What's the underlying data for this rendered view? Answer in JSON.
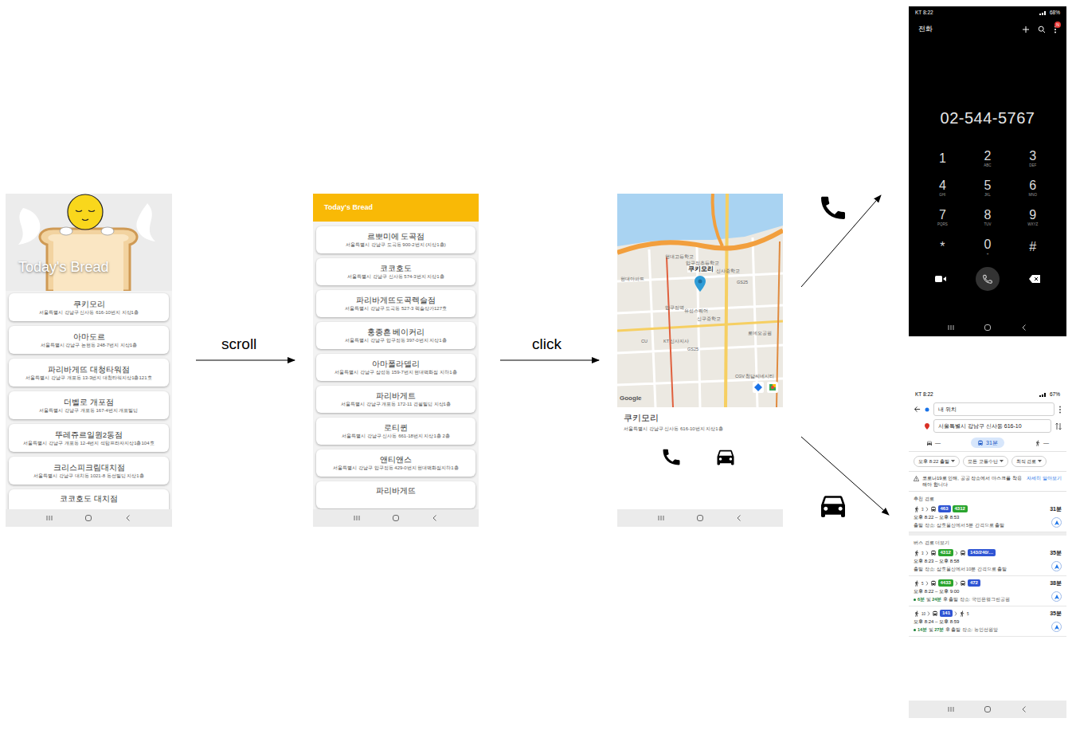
{
  "flow_labels": {
    "scroll": "scroll",
    "click": "click"
  },
  "screen1": {
    "title": "Today's Bread",
    "items": [
      {
        "name": "쿠키모리",
        "address": "서울특별시 강남구 신사동 616-10번지 지상1층"
      },
      {
        "name": "아마도르",
        "address": "서울특별시 강남구 논현동 248-7번지 지상1층"
      },
      {
        "name": "파리바게뜨 대청타워점",
        "address": "서울특별시 강남구 개포동 13-3번지 대청타워지상1층121호"
      },
      {
        "name": "더벨로 개포점",
        "address": "서울특별시 강남구 개포동 167-4번지 개포빌딩"
      },
      {
        "name": "뚜레쥬르일원2동점",
        "address": "서울특별시 강남구 개포동 12-4번지 석탑프라자지상1층104호"
      },
      {
        "name": "크리스피크림대치점",
        "address": "서울특별시 강남구 대치동 1021-8 동선빌딩 지상1층"
      }
    ],
    "partial_item": "코코호도 대치점"
  },
  "screen2": {
    "title": "Today's Bread",
    "items": [
      {
        "name": "르뽀미에 도곡점",
        "address": "서울특별시 강남구 도곡동 900-2번지 (지상1층)"
      },
      {
        "name": "코코호도",
        "address": "서울특별시 강남구 신사동 574-3번지 지상1층"
      },
      {
        "name": "파리바게뜨도곡렉슬점",
        "address": "서울특별시 강남구 도곡동 527-3 렉슬상가127호"
      },
      {
        "name": "홍종흔 베이커리",
        "address": "서울특별시 강남구 압구정동 397-0번지 지상1층"
      },
      {
        "name": "아마폴라델리",
        "address": "서울특별시 강남구 삼성동 159-7번지 현대백화점 지하1층"
      },
      {
        "name": "파리바게트",
        "address": "서울특별시 강남구 개포동 172-11 경필빌딩 지상1층"
      },
      {
        "name": "로티퀸",
        "address": "서울특별시 강남구 신사동 661-18번지 지상1층 2층"
      },
      {
        "name": "앤티앤스",
        "address": "서울특별시 강남구 압구정동 429-0번지 현대백화점지하1층"
      }
    ],
    "partial_item": "파리바게뜨"
  },
  "screen3": {
    "map": {
      "pin_label": "쿠키모리",
      "labels": [
        "현대고등학교",
        "압구정초등학교",
        "신사중학교",
        "현대아파트",
        "압구정역",
        "유성스퀘어",
        "신구중학교",
        "KT 신사지사",
        "GS25",
        "CU",
        "로데오공원",
        "CGV 청담씨네시티",
        "GS25"
      ],
      "attribution": "Google"
    },
    "name": "쿠키모리",
    "address": "서울특별시 강남구 신사동 616-10번지 지상1층"
  },
  "dialer": {
    "status": {
      "carrier_time": "KT 8:22",
      "battery": "68%"
    },
    "title": "전화",
    "badge": "N",
    "number": "02-544-5767",
    "keys": [
      {
        "digit": "1"
      },
      {
        "digit": "2",
        "letters": "ABC"
      },
      {
        "digit": "3",
        "letters": "DEF"
      },
      {
        "digit": "4",
        "letters": "GHI"
      },
      {
        "digit": "5",
        "letters": "JKL"
      },
      {
        "digit": "6",
        "letters": "MNO"
      },
      {
        "digit": "7",
        "letters": "PQRS"
      },
      {
        "digit": "8",
        "letters": "TUV"
      },
      {
        "digit": "9",
        "letters": "WXYZ"
      },
      {
        "digit": "*"
      },
      {
        "digit": "0",
        "letters": "+"
      },
      {
        "digit": "#"
      }
    ]
  },
  "directions": {
    "status": {
      "carrier_time": "KT 8:22",
      "battery": "67%"
    },
    "origin": "내 위치",
    "destination": "서울특별시 강남구 신사동 616-10",
    "modes": [
      {
        "kind": "car",
        "label": "—",
        "selected": false
      },
      {
        "kind": "transit",
        "label": "31분",
        "selected": true
      },
      {
        "kind": "walk",
        "label": "—",
        "selected": false
      }
    ],
    "filters": [
      "오후 8:22 출발",
      "모든 교통수단",
      "최적 경로"
    ],
    "notice": "코로나19로 인해, 공공 장소에서 마스크를 착용해야 합니다",
    "notice_link": "자세히 알아보기",
    "recommended_heading": "추천 경로",
    "more_heading": "버스 경로 더보기",
    "routes": [
      {
        "legs": [
          {
            "kind": "walk",
            "label": "3"
          },
          {
            "kind": "bus",
            "tags": [
              {
                "label": "463",
                "color": "#2f55d4"
              },
              {
                "label": "4312",
                "color": "#2aa52f"
              }
            ]
          }
        ],
        "duration": "31분",
        "time": "오후 8:22 – 오후 8:53",
        "detail": [
          {
            "text": "출발 장소: 삼호물산에서 5분 간격으로 출발",
            "highlight": false
          }
        ]
      },
      {
        "legs": [
          {
            "kind": "walk",
            "label": "3"
          },
          {
            "kind": "bus",
            "tags": [
              {
                "label": "4312",
                "color": "#2aa52f"
              }
            ]
          },
          {
            "kind": "bus",
            "tags": [
              {
                "label": "143/240/…",
                "color": "#2f55d4"
              }
            ]
          }
        ],
        "duration": "35분",
        "time": "오후 8:23 – 오후 8:58",
        "detail": [
          {
            "text": "출발 장소: 삼호물산에서 10분 간격으로 출발",
            "highlight": false
          }
        ]
      },
      {
        "legs": [
          {
            "kind": "walk",
            "label": "5"
          },
          {
            "kind": "bus",
            "tags": [
              {
                "label": "4433",
                "color": "#2aa52f"
              }
            ]
          },
          {
            "kind": "bus",
            "tags": [
              {
                "label": "472",
                "color": "#2f55d4"
              }
            ]
          }
        ],
        "duration": "38분",
        "time": "오후 8:22 – 오후 9:00",
        "detail": [
          {
            "text": "6분",
            "highlight": true
          },
          {
            "text": " 및 ",
            "highlight": false
          },
          {
            "text": "24분",
            "highlight": true
          },
          {
            "text": " 후 출발 장소: 국민은행그린공원",
            "highlight": false
          }
        ]
      },
      {
        "legs": [
          {
            "kind": "walk",
            "label": "10"
          },
          {
            "kind": "bus",
            "tags": [
              {
                "label": "141",
                "color": "#2f55d4"
              }
            ]
          },
          {
            "kind": "walk",
            "label": "5"
          }
        ],
        "duration": "35분",
        "time": "오후 8:24 – 오후 8:59",
        "detail": [
          {
            "text": "14분",
            "highlight": true
          },
          {
            "text": " 및 ",
            "highlight": false
          },
          {
            "text": "27분",
            "highlight": true
          },
          {
            "text": " 후 출발 장소: 농인선원앞",
            "highlight": false
          }
        ]
      }
    ]
  }
}
